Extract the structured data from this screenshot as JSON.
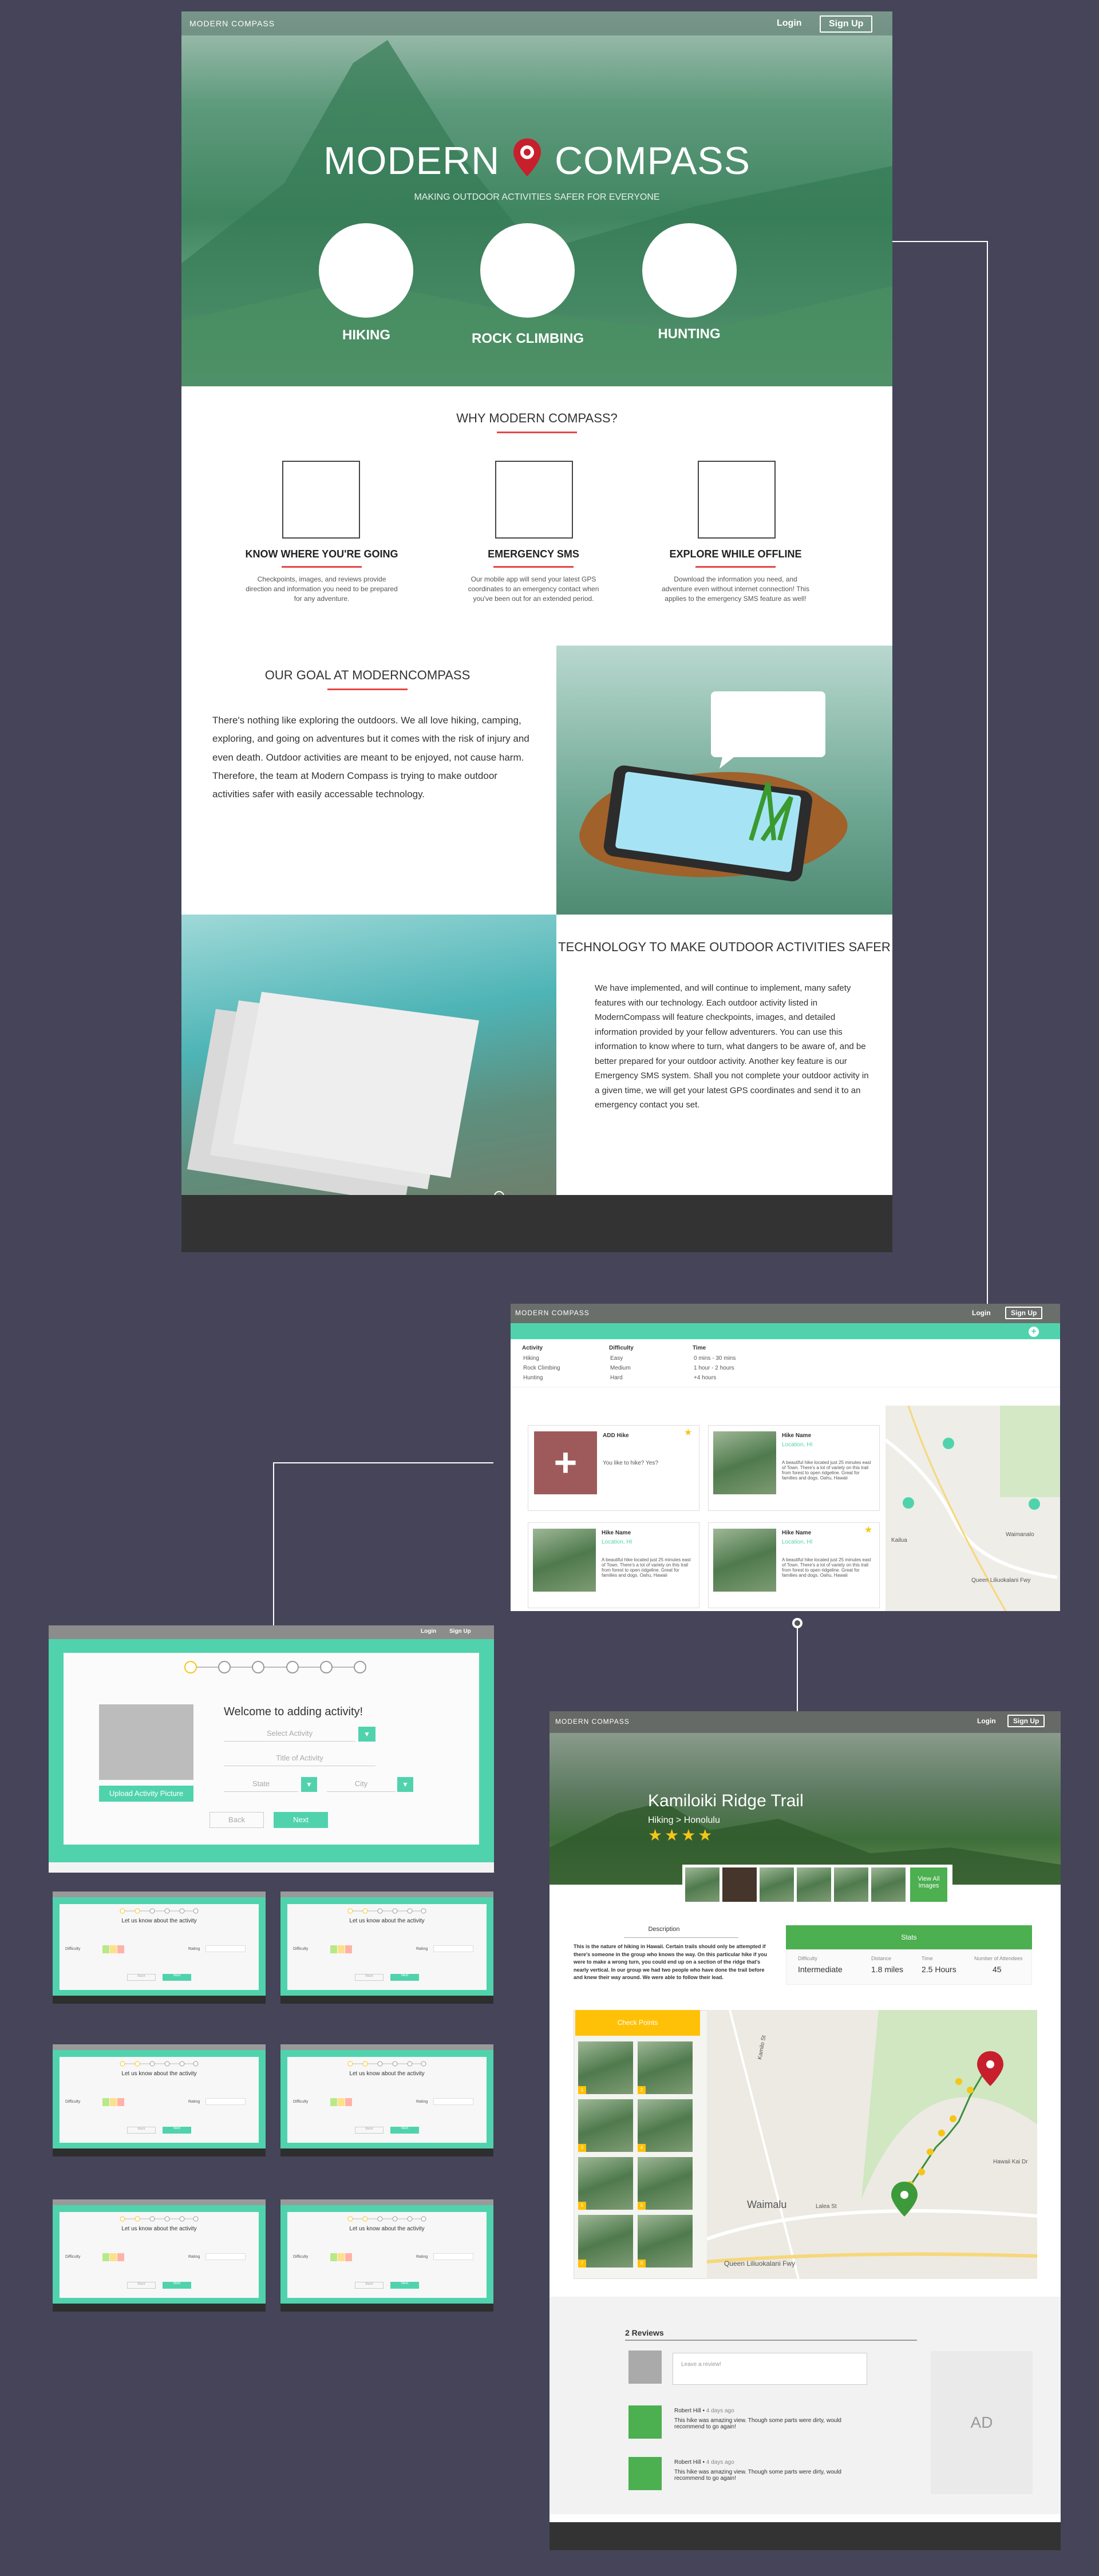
{
  "colors": {
    "bg": "#454459",
    "accent_teal": "#50d3ad",
    "accent_red": "#e84545",
    "green": "#4caf50",
    "yellow": "#ffc107"
  },
  "landing": {
    "logo": "MODERN COMPASS",
    "login": "Login",
    "signup": "Sign Up",
    "brand_left": "MODERN",
    "brand_right": "COMPASS",
    "tagline": "MAKING OUTDOOR ACTIVITIES SAFER FOR EVERYONE",
    "activities": [
      "HIKING",
      "ROCK CLIMBING",
      "HUNTING"
    ],
    "why_title": "WHY MODERN COMPASS?",
    "features": [
      {
        "title": "KNOW WHERE YOU'RE GOING",
        "desc": "Checkpoints, images, and reviews provide direction and information you need to be prepared for any adventure."
      },
      {
        "title": "EMERGENCY SMS",
        "desc": "Our mobile app will send your latest GPS coordinates to an emergency contact when you've been out for an extended period."
      },
      {
        "title": "EXPLORE WHILE OFFLINE",
        "desc": "Download the information you need, and adventure even without internet connection! This applies to the emergency SMS feature as well!"
      }
    ],
    "goal_title": "OUR GOAL AT MODERNCOMPASS",
    "goal_text": "There's nothing like exploring the outdoors. We all love hiking, camping, exploring, and going on adventures but it comes with the risk of injury and even death. Outdoor activities are meant to be enjoyed, not cause harm. Therefore, the team at Modern Compass is trying to make outdoor activities safer with easily accessable technology.",
    "tech_title": "TECHNOLOGY TO MAKE OUTDOOR ACTIVITIES SAFER",
    "tech_text": "We have implemented, and will continue to implement, many safety features with our technology. Each outdoor activity listed in ModernCompass will feature checkpoints, images, and detailed information provided by your fellow adventurers. You can use this information to know where to turn, what dangers to be aware of, and be better prepared for your outdoor activity. Another key feature is our Emergency SMS system. Shall you not complete your outdoor activity in a given time, we will get your latest GPS coordinates and send it to an emergency contact you set."
  },
  "search": {
    "logo": "MODERN COMPASS",
    "login": "Login",
    "signup": "Sign Up",
    "filters": [
      {
        "label": "Activity",
        "options": [
          "Hiking",
          "Rock Climbing",
          "Hunting"
        ]
      },
      {
        "label": "Difficulty",
        "options": [
          "Easy",
          "Medium",
          "Hard"
        ]
      },
      {
        "label": "Time",
        "options": [
          "0 mins - 30 mins",
          "1 hour - 2 hours",
          "+4 hours"
        ]
      }
    ],
    "cards": [
      {
        "title": "ADD Hike",
        "location": "",
        "desc": "You like to hike? Yes?"
      },
      {
        "title": "Hike Name",
        "location": "Location, HI",
        "desc": "A beautiful hike located just 25 minutes east of Town. There's a lot of variety on this trail from forest to open ridgeline. Great for families and dogs. Oahu, Hawaii"
      },
      {
        "title": "Hike Name",
        "location": "Location, HI",
        "desc": "A beautiful hike located just 25 minutes east of Town. There's a lot of variety on this trail from forest to open ridgeline. Great for families and dogs. Oahu, Hawaii"
      },
      {
        "title": "Hike Name",
        "location": "Location, HI",
        "desc": "A beautiful hike located just 25 minutes east of Town. There's a lot of variety on this trail from forest to open ridgeline. Great for families and dogs. Oahu, Hawaii"
      }
    ],
    "map_labels": [
      "Kailua",
      "Waimanalo",
      "Queen Liliuokalani Fwy"
    ]
  },
  "add": {
    "login": "Login",
    "signup": "Sign Up",
    "welcome": "Welcome to adding activity!",
    "select_placeholder": "Select Activity",
    "title_placeholder": "Title of Activity",
    "state_placeholder": "State",
    "city_placeholder": "City",
    "upload": "Upload Activity Picture",
    "back": "Back",
    "next": "Next",
    "mini_title": "Let us know about the activity",
    "mini_difficulty": "Difficulty",
    "mini_rating": "Rating"
  },
  "detail": {
    "logo": "MODERN COMPASS",
    "login": "Login",
    "signup": "Sign Up",
    "title": "Kamiloiki Ridge Trail",
    "subtitle": "Hiking > Honolulu",
    "rating": 4,
    "view_all": "View All Images",
    "description_label": "Description",
    "description": "This is the nature of hiking in Hawaii. Certain trails should only be attempted if there's someone in the group who knows the way. On this particular hike if you were to make a wrong turn, you could end up on a section of the ridge that's nearly vertical. In our group we had two people who have done the trail before and knew their way around. We were able to follow their lead.",
    "stats_label": "Stats",
    "stats": [
      {
        "label": "Difficulty",
        "value": "Intermediate"
      },
      {
        "label": "Distance",
        "value": "1.8 miles"
      },
      {
        "label": "Time",
        "value": "2.5 Hours"
      },
      {
        "label": "Number of Attendees",
        "value": "45"
      }
    ],
    "check_points": "Check Points",
    "map_labels": [
      "Kamilo St",
      "Hawaii Kai Dr",
      "Waimalu",
      "Lalea St",
      "Queen Liliuokalani Fwy"
    ],
    "reviews_title": "2 Reviews",
    "review_placeholder": "Leave a review!",
    "reviews": [
      {
        "author": "Robert Hill",
        "time": "4 days ago",
        "text": "This hike was amazing view. Though some parts were dirty, would recommend to go again!"
      },
      {
        "author": "Robert Hill",
        "time": "4 days ago",
        "text": "This hike was amazing view. Though some parts were dirty, would recommend to go again!"
      }
    ],
    "ad": "AD"
  }
}
